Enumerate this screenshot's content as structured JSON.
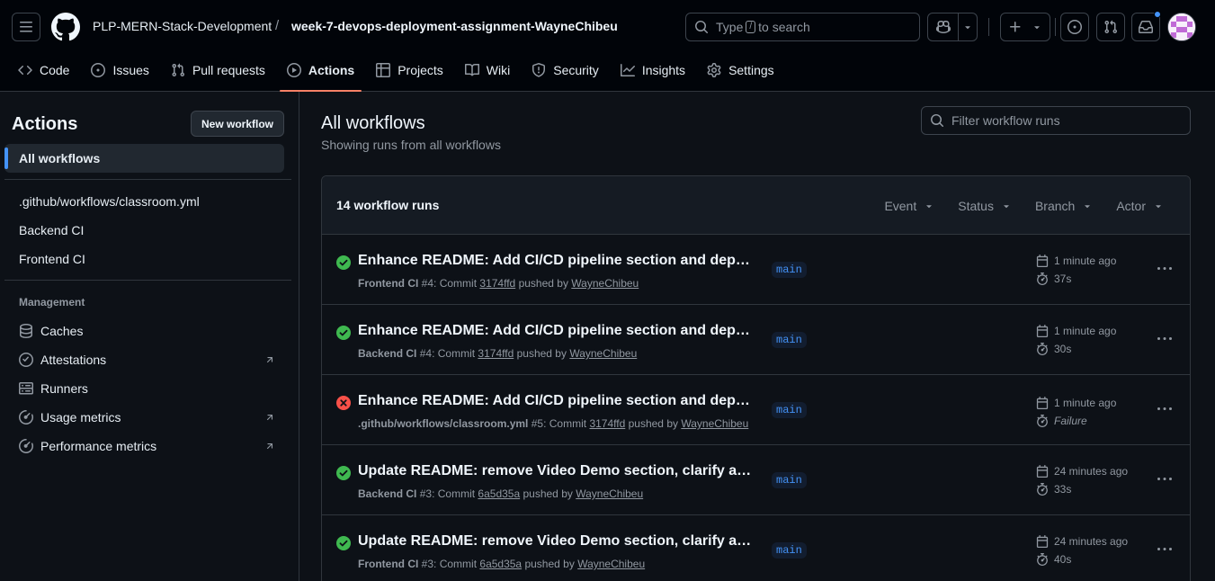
{
  "header": {
    "owner": "PLP-MERN-Stack-Development",
    "separator": "/",
    "repo": "week-7-devops-deployment-assignment-WayneChibeu",
    "search_prefix": "Type",
    "search_key": "/",
    "search_suffix": "to search"
  },
  "tabs": [
    {
      "label": "Code",
      "icon": "code-icon"
    },
    {
      "label": "Issues",
      "icon": "issue-icon"
    },
    {
      "label": "Pull requests",
      "icon": "pull-request-icon"
    },
    {
      "label": "Actions",
      "icon": "play-icon",
      "active": true
    },
    {
      "label": "Projects",
      "icon": "table-icon"
    },
    {
      "label": "Wiki",
      "icon": "book-icon"
    },
    {
      "label": "Security",
      "icon": "shield-icon"
    },
    {
      "label": "Insights",
      "icon": "graph-icon"
    },
    {
      "label": "Settings",
      "icon": "gear-icon"
    }
  ],
  "sidebar": {
    "title": "Actions",
    "new_workflow": "New workflow",
    "all_workflows": "All workflows",
    "workflows": [
      ".github/workflows/classroom.yml",
      "Backend CI",
      "Frontend CI"
    ],
    "management_heading": "Management",
    "management": [
      {
        "label": "Caches",
        "icon": "database-icon"
      },
      {
        "label": "Attestations",
        "icon": "verified-icon"
      },
      {
        "label": "Runners",
        "icon": "server-icon"
      },
      {
        "label": "Usage metrics",
        "icon": "meter-icon"
      },
      {
        "label": "Performance metrics",
        "icon": "meter-icon"
      }
    ]
  },
  "main": {
    "title": "All workflows",
    "subtitle": "Showing runs from all workflows",
    "filter_placeholder": "Filter workflow runs",
    "runs_count": "14 workflow runs",
    "filters": [
      "Event",
      "Status",
      "Branch",
      "Actor"
    ]
  },
  "runs": [
    {
      "status": "success",
      "title": "Enhance README: Add CI/CD pipeline section and deploy…",
      "workflow": "Frontend CI",
      "run_no": "#4",
      "commit_text": "Commit",
      "commit": "3174ffd",
      "pushed_by": "pushed by",
      "actor": "WayneChibeu",
      "branch": "main",
      "time": "1 minute ago",
      "duration": "37s"
    },
    {
      "status": "success",
      "title": "Enhance README: Add CI/CD pipeline section and deploy…",
      "workflow": "Backend CI",
      "run_no": "#4",
      "commit_text": "Commit",
      "commit": "3174ffd",
      "pushed_by": "pushed by",
      "actor": "WayneChibeu",
      "branch": "main",
      "time": "1 minute ago",
      "duration": "30s"
    },
    {
      "status": "failure",
      "title": "Enhance README: Add CI/CD pipeline section and deploy…",
      "workflow": ".github/workflows/classroom.yml",
      "run_no": "#5",
      "commit_text": "Commit",
      "commit": "3174ffd",
      "pushed_by": "pushed by",
      "actor": "WayneChibeu",
      "branch": "main",
      "time": "1 minute ago",
      "duration": "Failure"
    },
    {
      "status": "success",
      "title": "Update README: remove Video Demo section, clarify assi…",
      "workflow": "Backend CI",
      "run_no": "#3",
      "commit_text": "Commit",
      "commit": "6a5d35a",
      "pushed_by": "pushed by",
      "actor": "WayneChibeu",
      "branch": "main",
      "time": "24 minutes ago",
      "duration": "33s"
    },
    {
      "status": "success",
      "title": "Update README: remove Video Demo section, clarify assi…",
      "workflow": "Frontend CI",
      "run_no": "#3",
      "commit_text": "Commit",
      "commit": "6a5d35a",
      "pushed_by": "pushed by",
      "actor": "WayneChibeu",
      "branch": "main",
      "time": "24 minutes ago",
      "duration": "40s"
    }
  ],
  "colors": {
    "success": "#3fb950",
    "failure": "#f85149",
    "accent": "#4493f8",
    "active_tab_underline": "#f78166"
  }
}
